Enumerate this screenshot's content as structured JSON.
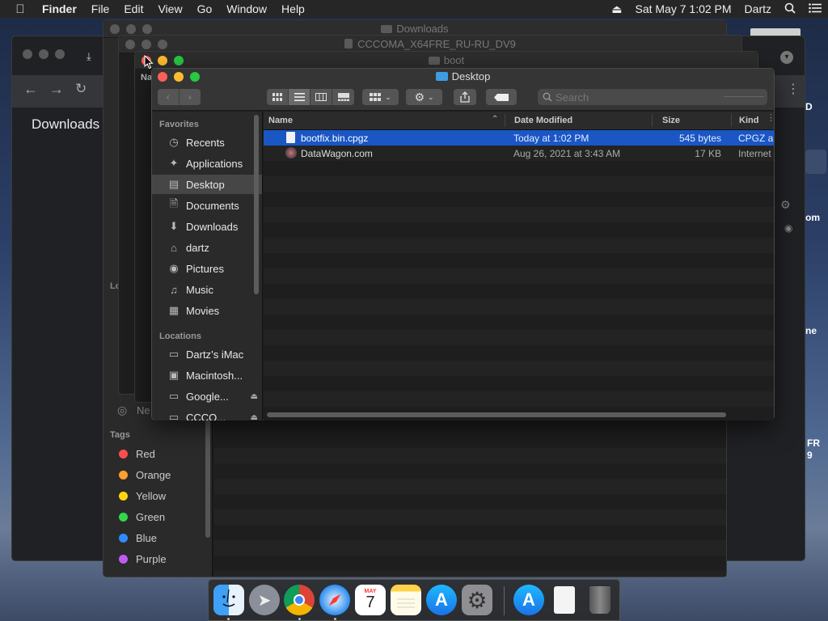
{
  "menubar": {
    "apple": "",
    "app_name": "Finder",
    "items": [
      "File",
      "Edit",
      "View",
      "Go",
      "Window",
      "Help"
    ],
    "clock": "Sat May 7  1:02 PM",
    "user": "Dartz"
  },
  "bg_windows": {
    "downloads_title": "Downloads",
    "cccoma_title": "CCCOMA_X64FRE_RU-RU_DV9",
    "boot_title": "boot",
    "chrome_page_title": "Downloads",
    "behind_header_name": "Na"
  },
  "bg_finder_sidebar": {
    "tags_heading": "Tags",
    "network_label": "Ne",
    "locations_partial": "Lo",
    "tags": [
      {
        "label": "Red",
        "color": "#ff4d4d"
      },
      {
        "label": "Orange",
        "color": "#ff9f2d"
      },
      {
        "label": "Yellow",
        "color": "#ffd60a"
      },
      {
        "label": "Green",
        "color": "#32d74b"
      },
      {
        "label": "Blue",
        "color": "#2f8cff"
      },
      {
        "label": "Purple",
        "color": "#bf5af2"
      }
    ]
  },
  "desktop_icon_labels": [
    "D",
    "om",
    "ne",
    "FR",
    "9"
  ],
  "finder": {
    "title": "Desktop",
    "search_placeholder": "Search",
    "sidebar": {
      "favorites_heading": "Favorites",
      "favorites": [
        {
          "label": "Recents",
          "icon": "clock-icon"
        },
        {
          "label": "Applications",
          "icon": "applications-icon"
        },
        {
          "label": "Desktop",
          "icon": "desktop-icon",
          "selected": true
        },
        {
          "label": "Documents",
          "icon": "document-icon"
        },
        {
          "label": "Downloads",
          "icon": "download-icon"
        },
        {
          "label": "dartz",
          "icon": "home-icon"
        },
        {
          "label": "Pictures",
          "icon": "camera-icon"
        },
        {
          "label": "Music",
          "icon": "music-icon"
        },
        {
          "label": "Movies",
          "icon": "film-icon"
        }
      ],
      "locations_heading": "Locations",
      "locations": [
        {
          "label": "Dartz’s iMac",
          "icon": "computer-icon"
        },
        {
          "label": "Macintosh...",
          "icon": "disk-icon"
        },
        {
          "label": "Google...",
          "icon": "disk-icon",
          "eject": true
        },
        {
          "label": "CCCO...",
          "icon": "disk-icon",
          "eject": true
        }
      ]
    },
    "columns": {
      "name": "Name",
      "date": "Date Modified",
      "size": "Size",
      "kind": "Kind"
    },
    "files": [
      {
        "name": "bootfix.bin.cpgz",
        "date": "Today at 1:02 PM",
        "size": "545 bytes",
        "kind": "CPGZ ar",
        "selected": true
      },
      {
        "name": "DataWagon.com",
        "date": "Aug 26, 2021 at 3:43 AM",
        "size": "17 KB",
        "kind": "Internet"
      }
    ]
  },
  "dock": {
    "calendar_month": "MAY",
    "calendar_day": "7",
    "apps": [
      "finder",
      "launchpad",
      "chrome",
      "safari",
      "calendar",
      "notes",
      "app-store",
      "system-preferences",
      "app-store-2",
      "preview",
      "trash"
    ]
  }
}
